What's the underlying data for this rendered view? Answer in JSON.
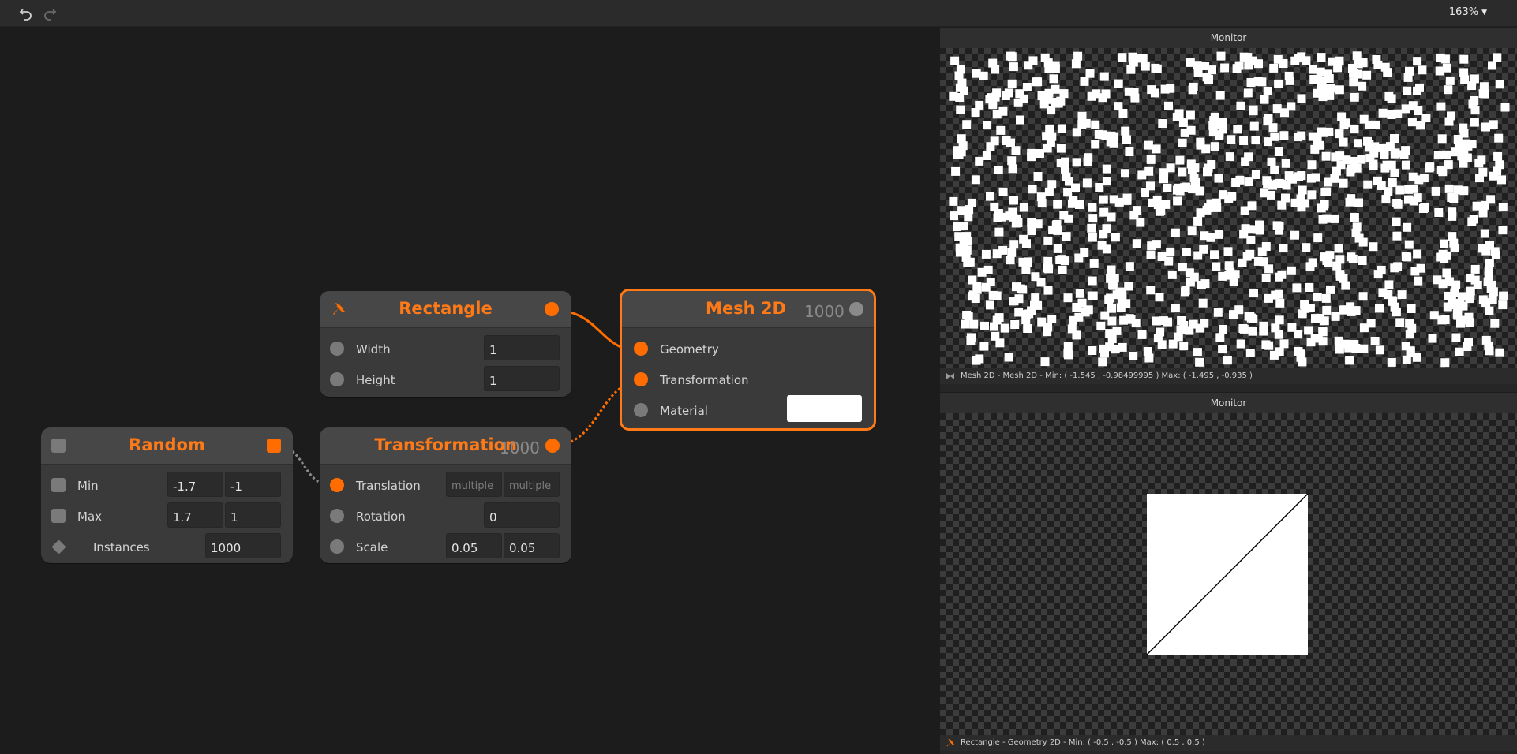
{
  "toolbar": {
    "zoom_label": "163%"
  },
  "nodes": {
    "rectangle": {
      "title": "Rectangle",
      "width_label": "Width",
      "width_value": "1",
      "height_label": "Height",
      "height_value": "1"
    },
    "random": {
      "title": "Random",
      "min_label": "Min",
      "min_x": "-1.7",
      "min_y": "-1",
      "max_label": "Max",
      "max_x": "1.7",
      "max_y": "1",
      "instances_label": "Instances",
      "instances_value": "1000"
    },
    "transformation": {
      "title": "Transformation",
      "count": "1000",
      "translation_label": "Translation",
      "translation_x": "multiple",
      "translation_y": "multiple",
      "rotation_label": "Rotation",
      "rotation_value": "0",
      "scale_label": "Scale",
      "scale_x": "0.05",
      "scale_y": "0.05"
    },
    "mesh2d": {
      "title": "Mesh 2D",
      "count": "1000",
      "geometry_label": "Geometry",
      "transformation_label": "Transformation",
      "material_label": "Material",
      "material_color": "#ffffff"
    }
  },
  "monitors": {
    "top": {
      "title": "Monitor",
      "status": "Mesh 2D - Mesh 2D - Min: ( -1.545 , -0.98499995 )  Max: ( -1.495 , -0.935 )"
    },
    "bottom": {
      "title": "Monitor",
      "status": "Rectangle - Geometry 2D - Min: ( -0.5 , -0.5 )  Max: ( 0.5 , 0.5 )"
    }
  },
  "colors": {
    "accent": "#ff6d00",
    "background": "#1c1c1c",
    "node": "#3a3a3a"
  }
}
